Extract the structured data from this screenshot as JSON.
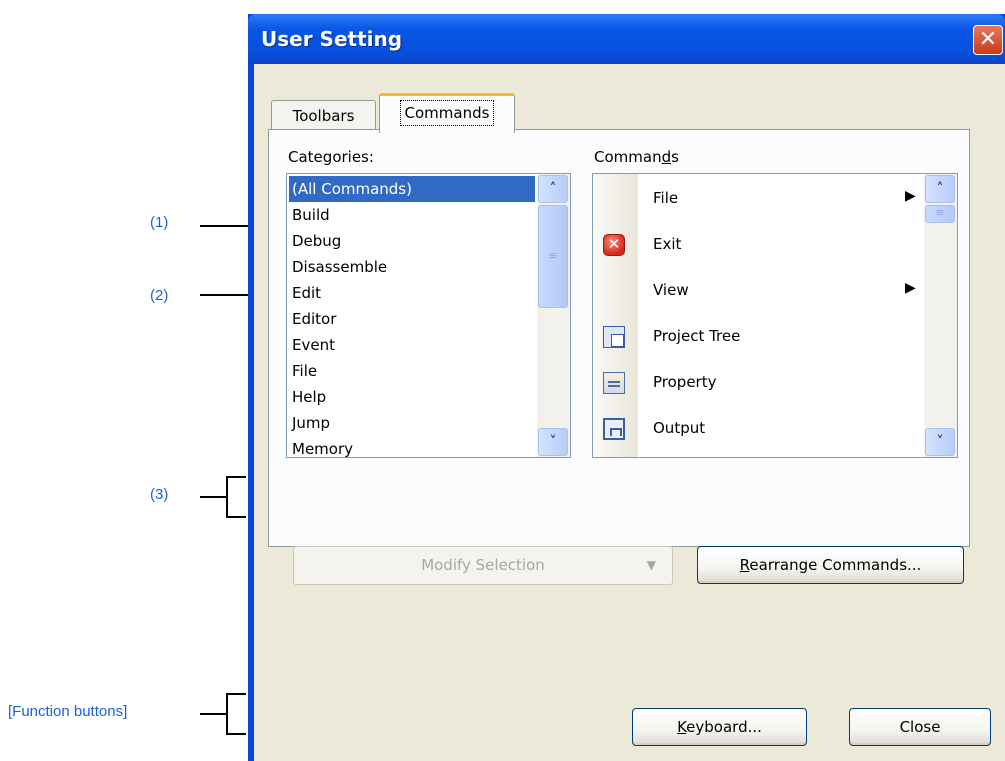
{
  "window": {
    "title": "User Setting",
    "close_glyph": "✕"
  },
  "tabs": [
    {
      "label": "Toolbars",
      "selected": false
    },
    {
      "label": "Commands",
      "selected": true
    }
  ],
  "categories": {
    "label": "Categories:",
    "items": [
      "(All Commands)",
      "Build",
      "Debug",
      "Disassemble",
      "Edit",
      "Editor",
      "Event",
      "File",
      "Help",
      "Jump",
      "Memory"
    ],
    "selected_index": 0
  },
  "commands": {
    "label": "Commands",
    "items": [
      {
        "label": "File",
        "icon": "none",
        "submenu": true
      },
      {
        "label": "Exit",
        "icon": "exit-icon",
        "submenu": false
      },
      {
        "label": "View",
        "icon": "none",
        "submenu": true
      },
      {
        "label": "Project Tree",
        "icon": "project-tree-icon",
        "submenu": false
      },
      {
        "label": "Property",
        "icon": "property-icon",
        "submenu": false
      },
      {
        "label": "Output",
        "icon": "output-icon",
        "submenu": false
      }
    ]
  },
  "buttons": {
    "modify_selection": "Modify Selection",
    "rearrange_pre": "R",
    "rearrange_rest": "earrange Commands...",
    "keyboard_pre": "K",
    "keyboard_rest": "eyboard...",
    "close": "Close"
  },
  "annotations": {
    "a1": "(1)",
    "a2": "(2)",
    "a3": "(3)",
    "function_buttons": "[Function buttons]"
  },
  "colors": {
    "title_bar": "#0650dc",
    "selection": "#316ac5",
    "annotation_text": "#1f5fd6",
    "tab_highlight": "#f6b532"
  }
}
